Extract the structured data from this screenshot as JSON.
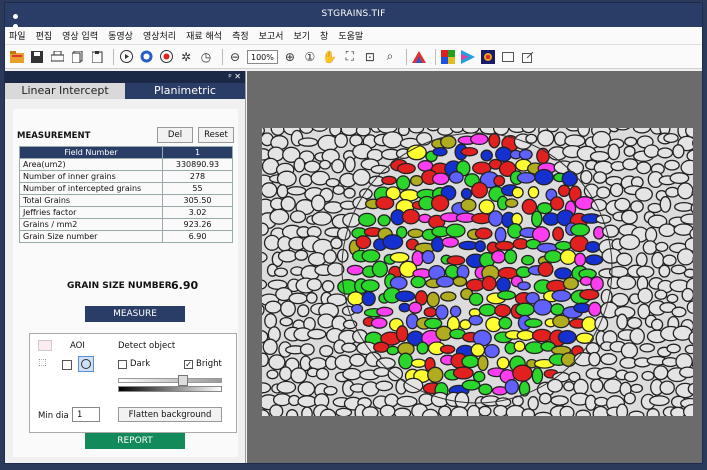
{
  "window": {
    "title": "STGRAINS.TIF"
  },
  "menu": [
    "파일",
    "편집",
    "영상 입력",
    "동영상",
    "영상처리",
    "재료 해석",
    "측정",
    "보고서",
    "보기",
    "창",
    "도움말"
  ],
  "toolbar": {
    "zoom": "100%"
  },
  "icons": {
    "new": "folder-icon",
    "save": "save-icon",
    "print": "print-icon",
    "copy": "copy-icon",
    "paste": "paste-icon",
    "play": "play-icon",
    "color": "palette-icon",
    "record": "record-icon",
    "settings": "gear-icon",
    "timer": "clock-icon",
    "zoom-out": "zoom-out-icon",
    "zoom-in": "zoom-in-icon",
    "one": "actual-size-icon",
    "pan": "hand-icon",
    "fit": "fit-icon",
    "crop": "crop-icon",
    "search": "search-icon",
    "chart": "histogram-icon"
  },
  "panel": {
    "pin": "ᵖ ✕",
    "tabs": [
      "Linear Intercept",
      "Planimetric"
    ],
    "measurement_title": "MEASUREMENT",
    "del_label": "Del",
    "reset_label": "Reset",
    "table": {
      "header": [
        "Field Number",
        "1"
      ],
      "rows": [
        [
          "Area(um2)",
          "330890.93"
        ],
        [
          "Number of inner grains",
          "278"
        ],
        [
          "Number of intercepted grains",
          "55"
        ],
        [
          "Total Grains",
          "305.50"
        ],
        [
          "Jeffries factor",
          "3.02"
        ],
        [
          "Grains / mm2",
          "923.26"
        ],
        [
          "Grain Size number",
          "6.90"
        ]
      ]
    },
    "grain_size_label": "GRAIN SIZE NUMBER",
    "grain_size_value": "6.90",
    "measure_label": "MEASURE",
    "aoi_label": "AOI",
    "detect_label": "Detect object",
    "dark_label": "Dark",
    "bright_label": "Bright",
    "min_dia_label": "Min dia",
    "min_dia_value": "1",
    "flatten_label": "Flatten background",
    "report_label": "REPORT"
  }
}
